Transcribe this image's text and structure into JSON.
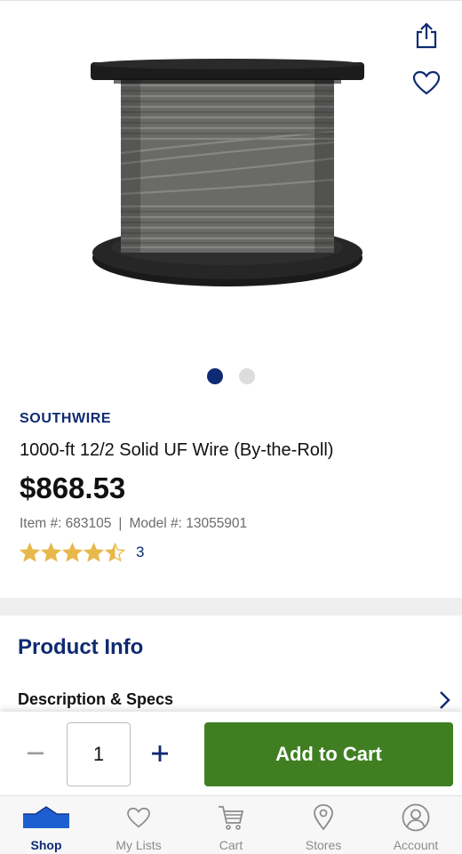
{
  "product": {
    "brand": "SOUTHWIRE",
    "title": "1000-ft 12/2 Solid UF Wire (By-the-Roll)",
    "price": "$868.53",
    "item_label": "Item #: 683105",
    "model_label": "Model #: 13055901",
    "separator": "|",
    "rating": 4.5,
    "max_rating": 5,
    "review_count": "3",
    "image_count": 2,
    "active_image": 1
  },
  "sections": {
    "product_info_title": "Product Info",
    "description_label": "Description & Specs"
  },
  "cart": {
    "quantity": "1",
    "add_label": "Add to Cart"
  },
  "tabs": [
    {
      "label": "Shop",
      "icon": "store-icon",
      "active": true
    },
    {
      "label": "My Lists",
      "icon": "heart-icon",
      "active": false
    },
    {
      "label": "Cart",
      "icon": "cart-icon",
      "active": false
    },
    {
      "label": "Stores",
      "icon": "location-pin-icon",
      "active": false
    },
    {
      "label": "Account",
      "icon": "account-icon",
      "active": false
    }
  ],
  "colors": {
    "brand_navy": "#0e2a72",
    "cart_green": "#3f7f22",
    "star_gold": "#e8b84a",
    "muted_gray": "#8c8c8c"
  }
}
